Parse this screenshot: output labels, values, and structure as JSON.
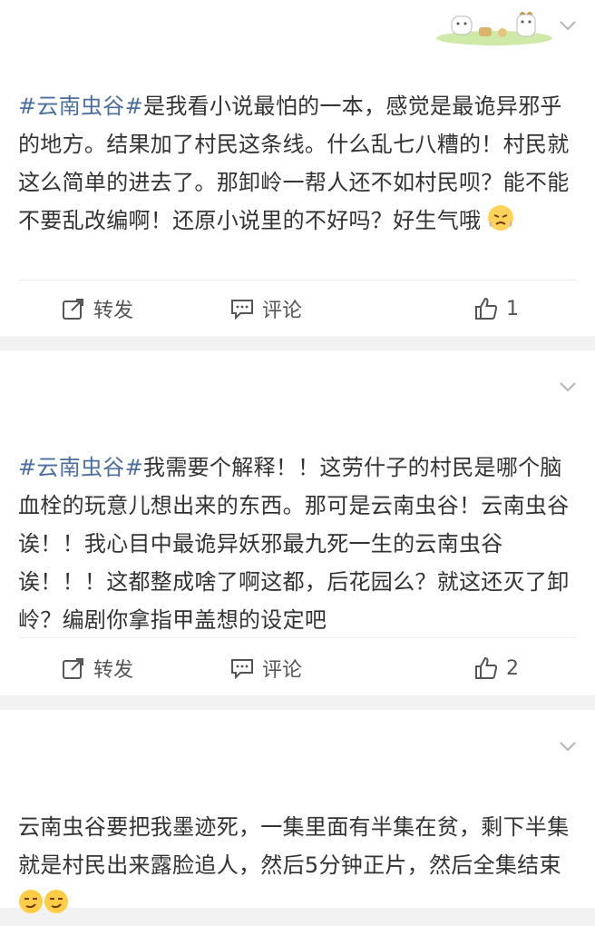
{
  "colors": {
    "hashtag": "#4a6fa0",
    "text": "#333333",
    "separator": "#f2f2f2",
    "icon": "#555555"
  },
  "posts": [
    {
      "hashtag": "#云南虫谷#",
      "text": "是我看小说最怕的一本，感觉是最诡异邪乎的地方。结果加了村民这条线。什么乱七八糟的！村民就这么简单的进去了。那卸岭一帮人还不如村民呗？能不能不要乱改编啊！还原小说里的不好吗？好生气哦",
      "emoji": [
        "angry-face-emoji"
      ],
      "actions": {
        "repost": "转发",
        "comment": "评论",
        "like_count": "1"
      }
    },
    {
      "hashtag": "#云南虫谷#",
      "text": "我需要个解释！！这劳什子的村民是哪个脑血栓的玩意儿想出来的东西。那可是云南虫谷！云南虫谷诶！！我心目中最诡异妖邪最九死一生的云南虫谷诶！！！这都整成啥了啊这都，后花园么？就这还灭了卸岭？编剧你拿指甲盖想的设定吧",
      "actions": {
        "repost": "转发",
        "comment": "评论",
        "like_count": "2"
      }
    },
    {
      "hashtag": "",
      "text": "云南虫谷要把我墨迹死，一集里面有半集在贫，剩下半集就是村民出来露脸追人，然后5分钟正片，然后全集结束",
      "emoji": [
        "smirk-face-emoji",
        "smirk-face-emoji"
      ]
    }
  ]
}
